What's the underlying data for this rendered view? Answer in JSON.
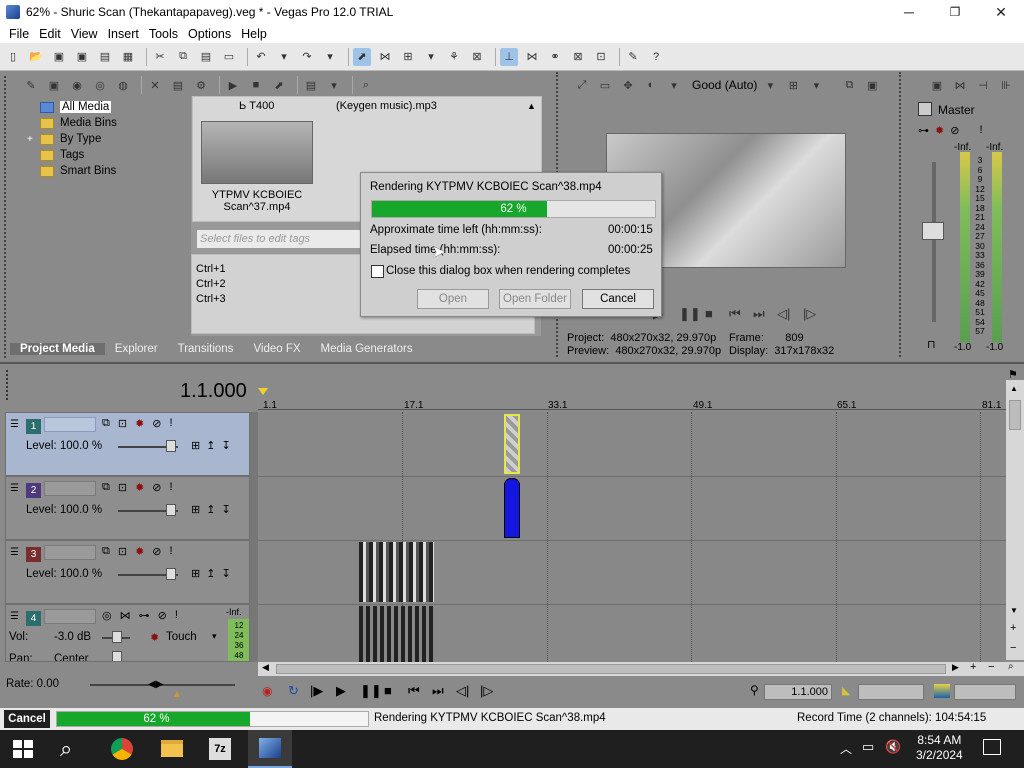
{
  "window": {
    "title": "62% - Shuric Scan (Thekantapapaveg).veg * - Vegas Pro 12.0 TRIAL",
    "minimize": "─",
    "maximize": "❐",
    "close": "✕"
  },
  "menu": [
    "File",
    "Edit",
    "View",
    "Insert",
    "Tools",
    "Options",
    "Help"
  ],
  "media_tree": {
    "items": [
      "All Media",
      "Media Bins",
      "By Type",
      "Tags",
      "Smart Bins"
    ],
    "expand": "+"
  },
  "media_files": {
    "file1": "Ь T400",
    "file2": "(Keygen music).mp3",
    "thumb_caption": "YTPMV KCBOIEC\nScan^37.mp4"
  },
  "tags": {
    "placeholder": "Select files to edit tags",
    "shortcuts": [
      "Ctrl+1",
      "Ctrl+2",
      "Ctrl+3"
    ]
  },
  "tabs": [
    "Project Media",
    "Explorer",
    "Transitions",
    "Video FX",
    "Media Generators"
  ],
  "preview": {
    "quality": "Good (Auto)",
    "project_label": "Project:",
    "project": "480x270x32, 29.970p",
    "frame_label": "Frame:",
    "frame": "809",
    "preview_label": "Preview:",
    "preview": "480x270x32, 29.970p",
    "display_label": "Display:",
    "display": "317x178x32"
  },
  "master": {
    "label": "Master",
    "inf": "-Inf.",
    "scale": [
      "3",
      "6",
      "9",
      "12",
      "15",
      "18",
      "21",
      "24",
      "27",
      "30",
      "33",
      "36",
      "39",
      "42",
      "45",
      "48",
      "51",
      "54",
      "57"
    ],
    "bottom_left": "-1.0",
    "bottom_right": "-1.0"
  },
  "timecode": "1.1.000",
  "ruler": [
    "1.1",
    "17.1",
    "33.1",
    "49.1",
    "65.1",
    "81.1"
  ],
  "tracks": [
    {
      "num": "1",
      "level": "Level: 100.0 %"
    },
    {
      "num": "2",
      "level": "Level: 100.0 %"
    },
    {
      "num": "3",
      "level": "Level: 100.0 %"
    },
    {
      "num": "4",
      "vol": "Vol:",
      "vol_val": "-3.0 dB",
      "pan": "Pan:",
      "pan_val": "Center",
      "touch": "Touch",
      "inf": "-Inf.",
      "meter": [
        "12",
        "24",
        "36",
        "48"
      ]
    }
  ],
  "transport": {
    "rate": "Rate: 0.00",
    "timecode": "1.1.000"
  },
  "dialog": {
    "title": "Rendering KYTPMV KCBOIEC Scan^38.mp4",
    "progress": 62,
    "progress_label": "62 %",
    "time_left_label": "Approximate time left (hh:mm:ss):",
    "time_left": "00:00:15",
    "elapsed_label": "Elapsed time (hh:mm:ss):",
    "elapsed": "00:00:25",
    "checkbox_label": "Close this dialog box when rendering completes",
    "open": "Open",
    "open_folder": "Open Folder",
    "cancel": "Cancel"
  },
  "status": {
    "cancel": "Cancel",
    "progress": 62,
    "progress_label": "62 %",
    "message": "Rendering KYTPMV KCBOIEC Scan^38.mp4",
    "record_time": "Record Time (2 channels): 104:54:15"
  },
  "taskbar": {
    "time": "8:54 AM",
    "date": "3/2/2024",
    "app_7z": "7z"
  },
  "colors": {
    "progress_green": "#17a82b",
    "clip_blue": "#1515e0",
    "track_selected": "#a8b7cf"
  }
}
